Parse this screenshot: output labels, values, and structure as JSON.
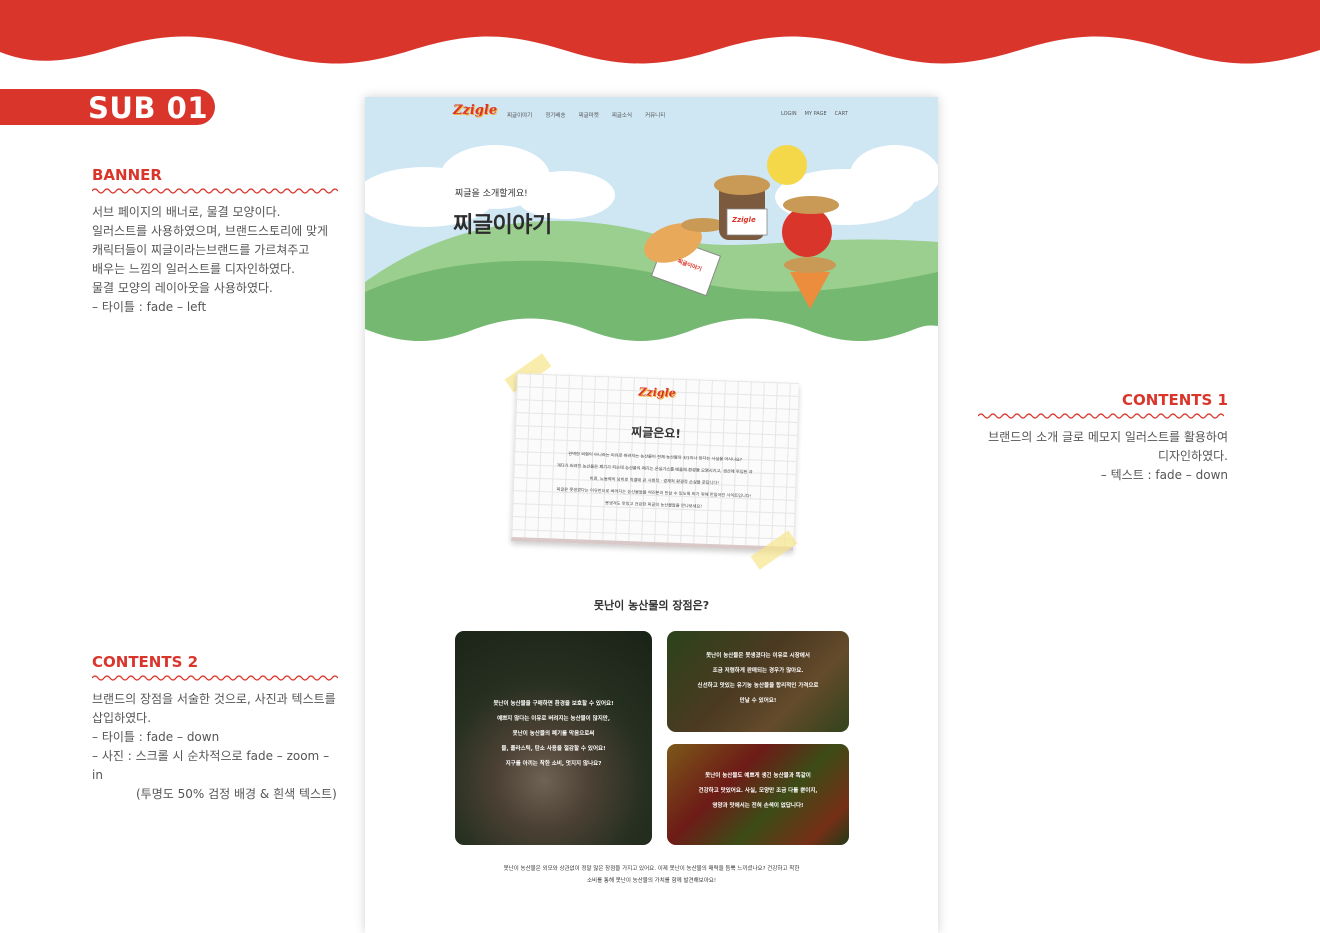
{
  "colors": {
    "brand_red": "#d9352b",
    "sky": "#cfe6f3",
    "hill_green": "#6fb56c",
    "text_dark": "#333333"
  },
  "sub_tag": "SUB 01",
  "annotations": {
    "banner": {
      "title": "BANNER",
      "lines": [
        "서브 페이지의 배너로, 물결 모양이다.",
        "일러스트를 사용하였으며, 브랜드스토리에 맞게",
        "캐릭터들이 찌글이라는브랜드를 가르쳐주고",
        "배우는 느낌의 일러스트를 디자인하였다.",
        "물결 모양의 레이아웃을 사용하였다.",
        "– 타이틀 : fade – left"
      ]
    },
    "contents1": {
      "title": "CONTENTS 1",
      "lines": [
        "브랜드의 소개 글로 메모지 일러스트를 활용하여",
        "디자인하였다.",
        "– 텍스트 :  fade – down"
      ]
    },
    "contents2": {
      "title": "CONTENTS 2",
      "lines": [
        "브랜드의 장점을 서술한 것으로, 사진과 텍스트를",
        "삽입하였다.",
        "– 타이틀 : fade – down",
        "– 사진 : 스크롤 시 순차적으로 fade – zoom – in",
        "(투명도 50% 검정 배경 & 흰색 텍스트)"
      ]
    }
  },
  "mockup": {
    "logo": "Zzigle",
    "nav": [
      "찌글이야기",
      "정기배송",
      "찌글마켓",
      "찌글소식",
      "커뮤니티"
    ],
    "util": [
      "LOGIN",
      "MY PAGE",
      "CART"
    ],
    "hero_subtitle": "찌글을 소개할게요!",
    "hero_title": "찌글이야기",
    "hero_sign_bread": "Zzigle",
    "hero_sign_potato": "찌글이야기",
    "memo": {
      "logo": "Zzigle",
      "title": "찌글은요!",
      "lines": [
        "완벽한 외형이 아니라는 이유로 버려지는 농산물이 전체 농산물의 3/1이나 된다는 사실을 아시나요?",
        "계다가 버려진 농산물은 폐기가 되는데 농산물의 폐기는 온실가스를 배출해 환경을 오염시키고, 생산에 투입된 과",
        "비료, 노동력의 낭비로 직결돼 큰 사회적 · 경제적 환경적 손실을 준답니다!",
        "찌글은 못생겼다는 이유만으로 버려지는 농산물들을 여러분과 만날 수 있도록 하기 위해 만들어진 사이트입니다!",
        "못생겨도 맛있고 건강한 찌글의 농산물들을 만나보세요!"
      ]
    },
    "section_title": "못난이 농산물의 장점은?",
    "cards": [
      {
        "lines": [
          "못난이 농산물을 구매하면 환경을 보호할 수 있어요!",
          "예쁘지 않다는 이유로 버려지는 농산물이 많지만,",
          "못난이 농산물의 폐기를 막음으로써",
          "물, 플라스틱, 탄소 사용을 절감할 수 있어요!",
          "지구를 아끼는 착한 소비, 멋지지 않나요?"
        ]
      },
      {
        "lines": [
          "못난이 농산물은 못생겼다는 이유로 시장에서",
          "조금 저렴하게 판매되는 경우가 많아요.",
          "신선하고 맛있는 유기농 농산물을 합리적인 가격으로",
          "만날 수 있어요!"
        ]
      },
      {
        "lines": [
          "못난이 농산물도 예쁘게 생긴 농산물과 똑같이",
          "건강하고 맛있어요. 사실, 모양만 조금 다를 뿐이지,",
          "영양과 맛에서는 전혀 손색이 없답니다!"
        ]
      }
    ],
    "bottom_lines": [
      "못난이 농산물은 외모와 상관없이 정말 많은 장점을 가지고 있어요. 이제 못난이 농산물의 매력을 듬뿍 느끼셨나요? 건강하고 착한",
      "소비를 통해 못난이 농산물의 가치를 함께 발견해보아요!"
    ]
  }
}
